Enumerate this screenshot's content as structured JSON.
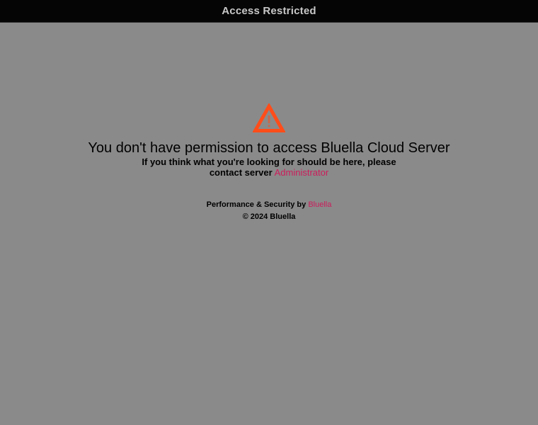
{
  "header": {
    "title": "Access Restricted"
  },
  "main": {
    "icon": "warning-triangle-icon",
    "icon_color": "#ff4d1a",
    "headline": "You don't have permission to access Bluella Cloud Server",
    "subline": "If you think what you're looking for should be here, please",
    "subline2_prefix": "contact server",
    "admin_link": "Administrator"
  },
  "footer": {
    "performance_prefix": "Performance & Security by",
    "brand_link": "Bluella",
    "copyright": "© 2024 Bluella"
  },
  "colors": {
    "background": "#8a8a8a",
    "topbar": "#050505",
    "link": "#cc1c5a",
    "warning": "#ff4d1a"
  }
}
